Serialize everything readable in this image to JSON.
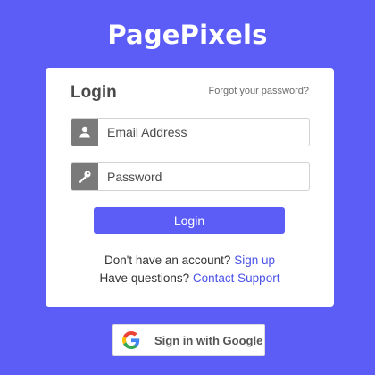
{
  "brand": {
    "name": "PagePixels"
  },
  "login": {
    "title": "Login",
    "forgot_link": "Forgot your password?",
    "email": {
      "placeholder": "Email Address",
      "value": "",
      "icon": "user-icon"
    },
    "password": {
      "placeholder": "Password",
      "value": "",
      "icon": "key-icon"
    },
    "submit_label": "Login",
    "signup_prompt": "Don't have an account?",
    "signup_link": "Sign up",
    "support_prompt": "Have questions?",
    "support_link": "Contact Support"
  },
  "google": {
    "label": "Sign in with Google",
    "icon": "google-icon"
  },
  "colors": {
    "background": "#5c5df6",
    "accent": "#5c5df6",
    "link": "#4a52e8",
    "addon": "#7a7a7a"
  }
}
